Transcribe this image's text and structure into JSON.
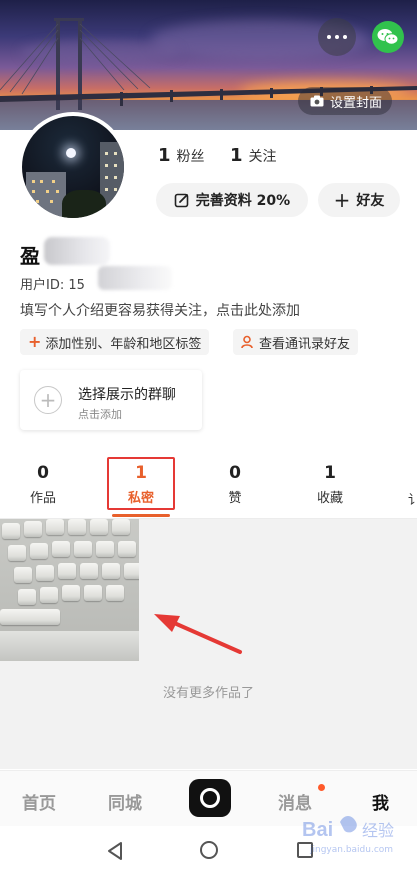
{
  "header": {
    "set_cover_label": "设置封面",
    "more_icon": "more-dots-icon",
    "share_icon": "wechat-icon"
  },
  "profile": {
    "username_visible": "盈",
    "uid_label": "用户ID: 15",
    "bio": "填写个人介绍更容易获得关注，点击此处添加",
    "stats": [
      {
        "value": "1",
        "label": "粉丝"
      },
      {
        "value": "1",
        "label": "关注"
      }
    ],
    "complete_profile_label": "完善资料 20%",
    "add_friend_label": "好友",
    "tags": [
      {
        "label": "添加性别、年龄和地区标签"
      },
      {
        "label": "查看通讯录好友"
      }
    ],
    "group_card": {
      "title": "选择展示的群聊",
      "subtitle": "点击添加"
    }
  },
  "tabs": [
    {
      "count": "0",
      "label": "作品",
      "active": false
    },
    {
      "count": "1",
      "label": "私密",
      "active": true
    },
    {
      "count": "0",
      "label": "赞",
      "active": false
    },
    {
      "count": "1",
      "label": "收藏",
      "active": false
    }
  ],
  "tab_overflow_label": "讠",
  "content": {
    "no_more_label": "没有更多作品了"
  },
  "bottom_nav": {
    "items": [
      {
        "label": "首页",
        "active": false
      },
      {
        "label": "同城",
        "active": false
      },
      {
        "label": "消息",
        "active": false
      },
      {
        "label": "我",
        "active": true
      }
    ]
  },
  "colors": {
    "accent": "#e8602c",
    "highlight_box": "#e53935",
    "wechat": "#31c24d"
  },
  "watermark": {
    "text": "Bai 经验",
    "sub": "jingyan.baidu.com"
  }
}
